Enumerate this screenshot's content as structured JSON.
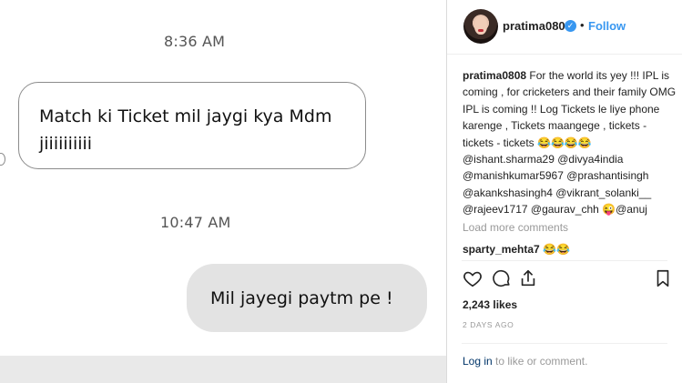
{
  "chat": {
    "timestamp_1": "8:36 AM",
    "incoming_message": "Match ki Ticket mil jaygi kya Mdm jiiiiiiiiii",
    "timestamp_2": "10:47 AM",
    "outgoing_message": "Mil jayegi paytm pe !"
  },
  "post": {
    "username": "pratima0808",
    "separator": "•",
    "follow_label": "Follow",
    "caption_username": "pratima0808",
    "caption_text": "For the world its yey !!! IPL is coming , for cricketers and their family OMG IPL is coming !! Log Tickets le liye phone karenge , Tickets maangege , tickets - tickets - tickets 😂😂😂😂 @ishant.sharma29 @divya4india @manishkumar5967 @prashantisingh @akankshasingh4 @vikrant_solanki__ @rajeev1717 @gaurav_chh 😜@anuj",
    "load_more": "Load more comments",
    "comment_username": "sparty_mehta7",
    "comment_text": " 😂😂",
    "likes": "2,243 likes",
    "time_ago": "2 DAYS AGO",
    "login_link": "Log in",
    "login_rest": " to like or comment."
  },
  "colors": {
    "link_blue": "#3897f0",
    "bubble_gray": "#e3e3e3",
    "muted_text": "#999999"
  },
  "icons": [
    "heart-icon",
    "comment-icon",
    "share-icon",
    "bookmark-icon",
    "verified-badge-icon"
  ]
}
